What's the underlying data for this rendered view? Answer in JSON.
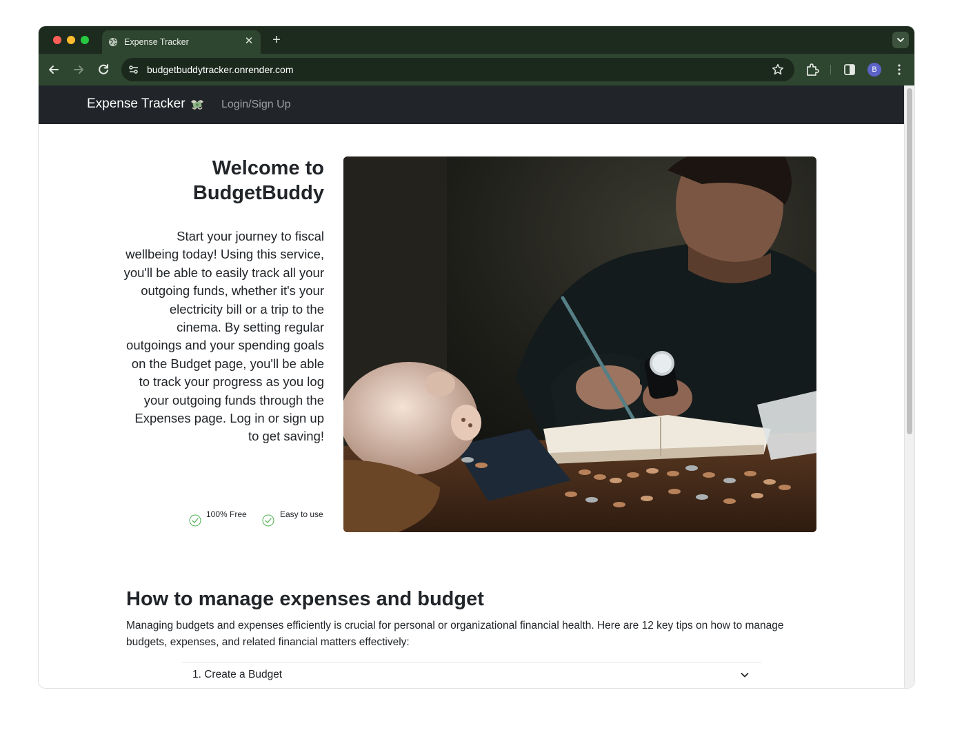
{
  "browser": {
    "tab_title": "Expense Tracker",
    "tab_icon": "globe-icon",
    "url": "budgetbuddytracker.onrender.com",
    "avatar_initial": "B"
  },
  "navbar": {
    "brand": "Expense Tracker",
    "brand_icon": "money-wings-icon",
    "login_link": "Login/Sign Up"
  },
  "hero": {
    "title_line1": "Welcome to",
    "title_line2": "BudgetBuddy",
    "description": "Start your journey to fiscal wellbeing today! Using this service, you'll be able to easily track all your outgoing funds, whether it's your electricity bill or a trip to the cinema. By setting regular outgoings and your spending goals on the Budget page, you'll be able to track your progress as you log your outgoing funds through the Expenses page. Log in or sign up to get saving!",
    "features": [
      "100% Free",
      "Easy to use"
    ],
    "image": "man-writing-budget-with-piggy-bank-photo"
  },
  "section": {
    "title": "How to manage expenses and budget",
    "intro": "Managing budgets and expenses efficiently is crucial for personal or organizational financial health. Here are 12 key tips on how to manage budgets, expenses, and related financial matters effectively:",
    "accordion": [
      {
        "label": "1. Create a Budget",
        "expanded": false
      }
    ]
  },
  "colors": {
    "navbar_bg": "#212529",
    "browser_frame": "#1d2b1e",
    "check_green": "#4caf50"
  }
}
